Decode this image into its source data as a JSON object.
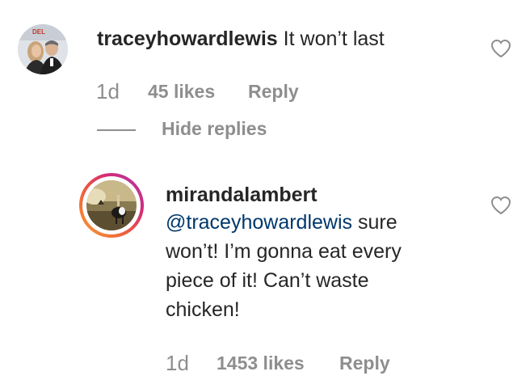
{
  "comments": [
    {
      "username": "traceyhowardlewis",
      "text": "It won’t last",
      "time": "1d",
      "likes": "45 likes",
      "reply": "Reply",
      "avatar_text": "DEL"
    }
  ],
  "hide_replies": "Hide replies",
  "replies": [
    {
      "username": "mirandalambert",
      "mention": "@traceyhowardlewis",
      "text_line1_rest": " sure",
      "text_line2": "won’t! I’m gonna eat every",
      "text_line3": "piece of it! Can’t waste",
      "text_line4": "chicken!",
      "time": "1d",
      "likes": "1453 likes",
      "reply": "Reply"
    }
  ],
  "colors": {
    "text": "#262626",
    "secondary": "#8e8e8e",
    "mention": "#00376b",
    "story_ring_start": "#f9a030",
    "story_ring_end": "#a53fb3"
  },
  "icons": {
    "like": "heart-outline-icon"
  }
}
